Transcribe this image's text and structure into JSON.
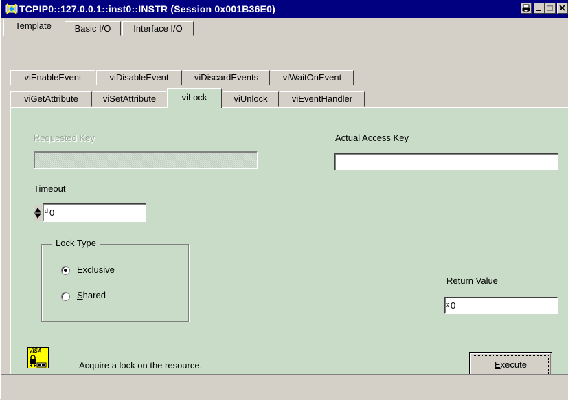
{
  "window": {
    "title": "TCPIP0::127.0.0.1::inst0::INSTR (Session 0x001B36E0)"
  },
  "outer_tabs": [
    {
      "label": "Template",
      "active": true
    },
    {
      "label": "Basic I/O",
      "active": false
    },
    {
      "label": "Interface I/O",
      "active": false
    }
  ],
  "inner_tabs_row1": [
    "viEnableEvent",
    "viDisableEvent",
    "viDiscardEvents",
    "viWaitOnEvent"
  ],
  "inner_tabs_row2": [
    "viGetAttribute",
    "viSetAttribute",
    "viLock",
    "viUnlock",
    "viEventHandler"
  ],
  "active_inner_tab": "viLock",
  "form": {
    "requested_key_label": "Requested Key",
    "requested_key_value": "",
    "actual_access_key_label": "Actual Access Key",
    "actual_access_key_value": "",
    "timeout_label": "Timeout",
    "timeout_value": "0",
    "timeout_indicator": "d",
    "lock_type_label": "Lock Type",
    "lock_type_options": [
      {
        "label_pre": "E",
        "label_ul": "x",
        "label_post": "clusive",
        "selected": true
      },
      {
        "label_pre": "",
        "label_ul": "S",
        "label_post": "hared",
        "selected": false
      }
    ],
    "return_value_label": "Return Value",
    "return_value": "0",
    "return_value_indicator": "x"
  },
  "footer": {
    "visa_badge": "VISA",
    "description": "Acquire a lock on the resource.",
    "execute_label_ul": "E",
    "execute_label_rest": "xecute"
  },
  "colors": {
    "titlebar": "#000080",
    "panel": "#c8dcc8",
    "chrome": "#d4d0c8",
    "visa_badge": "#ffff00"
  }
}
